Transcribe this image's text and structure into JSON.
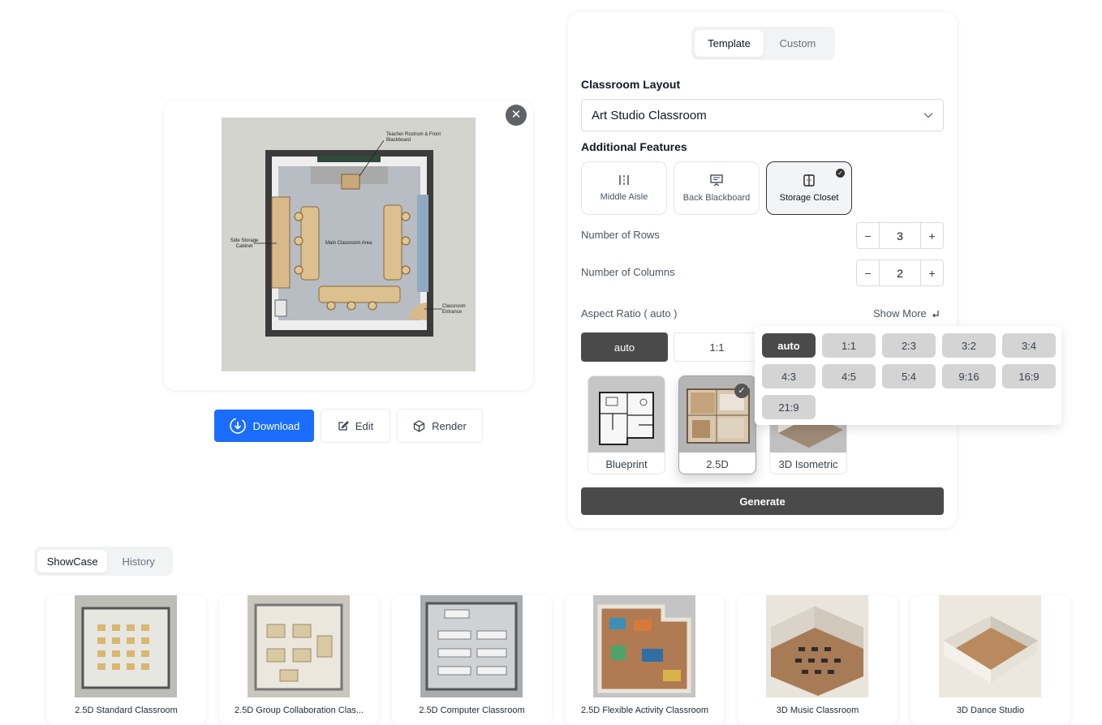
{
  "preview": {
    "labels": {
      "rostrum": "Teacher Rostrum & Front Blackboard",
      "storage": "Side Storage Cabinet",
      "main_area": "Main Classroom Area",
      "entrance": "Classroom Entrance"
    },
    "close_symbol": "✕"
  },
  "actions": {
    "download": "Download",
    "edit": "Edit",
    "render": "Render"
  },
  "panel": {
    "tabs": [
      {
        "label": "Template",
        "active": true
      },
      {
        "label": "Custom",
        "active": false
      }
    ],
    "layout_label": "Classroom Layout",
    "layout_value": "Art Studio Classroom",
    "features_label": "Additional Features",
    "features": [
      {
        "label": "Middle Aisle",
        "icon": "middle-aisle-icon",
        "selected": false
      },
      {
        "label": "Back Blackboard",
        "icon": "blackboard-icon",
        "selected": false
      },
      {
        "label": "Storage Closet",
        "icon": "closet-icon",
        "selected": true
      }
    ],
    "rows_label": "Number of Rows",
    "rows_value": "3",
    "cols_label": "Number of Columns",
    "cols_value": "2",
    "minus": "−",
    "plus": "+",
    "aspect_label": "Aspect Ratio ( auto )",
    "show_more": "Show More",
    "quick_ratios": [
      "auto",
      "1:1"
    ],
    "styles": [
      {
        "label": "Blueprint",
        "selected": false
      },
      {
        "label": "2.5D",
        "selected": true
      },
      {
        "label": "3D Isometric",
        "selected": false
      }
    ],
    "generate": "Generate"
  },
  "ratio_dropdown": {
    "options": [
      "auto",
      "1:1",
      "2:3",
      "3:2",
      "3:4",
      "4:3",
      "4:5",
      "5:4",
      "9:16",
      "16:9",
      "21:9"
    ],
    "selected": "auto"
  },
  "gallery": {
    "tabs": [
      {
        "label": "ShowCase",
        "active": true
      },
      {
        "label": "History",
        "active": false
      }
    ],
    "items": [
      {
        "label": "2.5D Standard Classroom"
      },
      {
        "label": "2.5D Group Collaboration Clas..."
      },
      {
        "label": "2.5D Computer Classroom"
      },
      {
        "label": "2.5D Flexible Activity Classroom"
      },
      {
        "label": "3D Music Classroom"
      },
      {
        "label": "3D Dance Studio"
      }
    ]
  },
  "colors": {
    "primary": "#1a6dff",
    "dark": "#4a4a4a"
  }
}
